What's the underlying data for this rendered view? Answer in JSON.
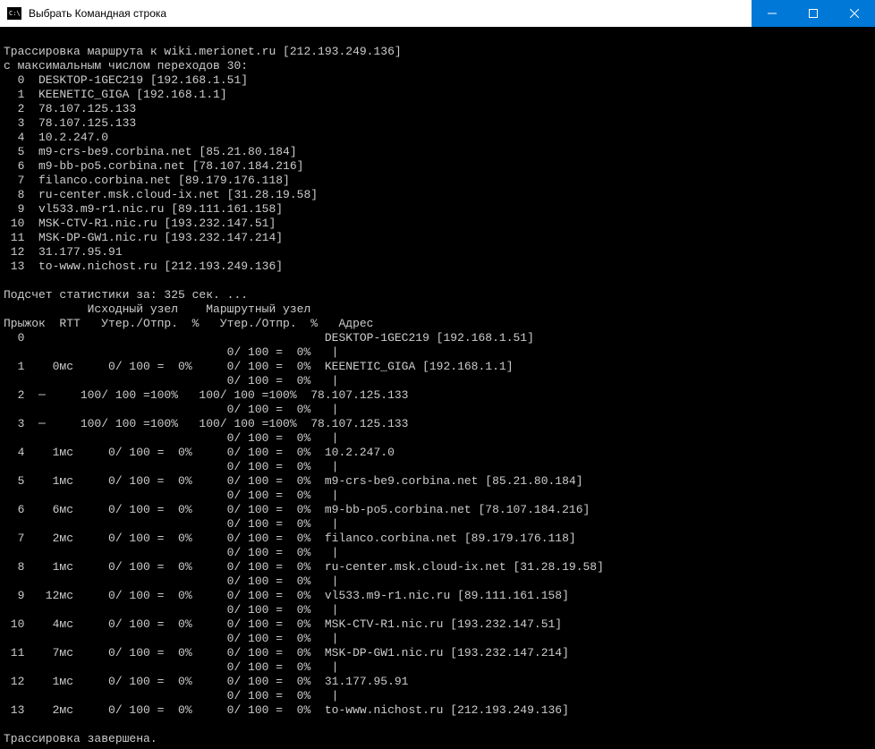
{
  "window": {
    "title": "Выбрать Командная строка"
  },
  "terminal": {
    "header1": "Трассировка маршрута к wiki.merionet.ru [212.193.249.136]",
    "header2": "с максимальным числом переходов 30:",
    "route": [
      "  0  DESKTOP-1GEC219 [192.168.1.51]",
      "  1  KEENETIC_GIGA [192.168.1.1]",
      "  2  78.107.125.133",
      "  3  78.107.125.133",
      "  4  10.2.247.0",
      "  5  m9-crs-be9.corbina.net [85.21.80.184]",
      "  6  m9-bb-po5.corbina.net [78.107.184.216]",
      "  7  filanco.corbina.net [89.179.176.118]",
      "  8  ru-center.msk.cloud-ix.net [31.28.19.58]",
      "  9  vl533.m9-r1.nic.ru [89.111.161.158]",
      " 10  MSK-CTV-R1.nic.ru [193.232.147.51]",
      " 11  MSK-DP-GW1.nic.ru [193.232.147.214]",
      " 12  31.177.95.91",
      " 13  to-www.nichost.ru [212.193.249.136]"
    ],
    "statsHeader1": "Подсчет статистики за: 325 сек. ...",
    "statsHeader2": "            Исходный узел    Маршрутный узел",
    "statsHeader3": "Прыжок  RTT   Утер./Отпр.  %   Утер./Отпр.  %   Адрес",
    "stats": [
      "  0                                           DESKTOP-1GEC219 [192.168.1.51]",
      "                                0/ 100 =  0%   |",
      "  1    0мс     0/ 100 =  0%     0/ 100 =  0%  KEENETIC_GIGA [192.168.1.1]",
      "                                0/ 100 =  0%   |",
      "  2  ─     100/ 100 =100%   100/ 100 =100%  78.107.125.133",
      "                                0/ 100 =  0%   |",
      "  3  ─     100/ 100 =100%   100/ 100 =100%  78.107.125.133",
      "                                0/ 100 =  0%   |",
      "  4    1мс     0/ 100 =  0%     0/ 100 =  0%  10.2.247.0",
      "                                0/ 100 =  0%   |",
      "  5    1мс     0/ 100 =  0%     0/ 100 =  0%  m9-crs-be9.corbina.net [85.21.80.184]",
      "                                0/ 100 =  0%   |",
      "  6    6мс     0/ 100 =  0%     0/ 100 =  0%  m9-bb-po5.corbina.net [78.107.184.216]",
      "                                0/ 100 =  0%   |",
      "  7    2мс     0/ 100 =  0%     0/ 100 =  0%  filanco.corbina.net [89.179.176.118]",
      "                                0/ 100 =  0%   |",
      "  8    1мс     0/ 100 =  0%     0/ 100 =  0%  ru-center.msk.cloud-ix.net [31.28.19.58]",
      "                                0/ 100 =  0%   |",
      "  9   12мс     0/ 100 =  0%     0/ 100 =  0%  vl533.m9-r1.nic.ru [89.111.161.158]",
      "                                0/ 100 =  0%   |",
      " 10    4мс     0/ 100 =  0%     0/ 100 =  0%  MSK-CTV-R1.nic.ru [193.232.147.51]",
      "                                0/ 100 =  0%   |",
      " 11    7мс     0/ 100 =  0%     0/ 100 =  0%  MSK-DP-GW1.nic.ru [193.232.147.214]",
      "                                0/ 100 =  0%   |",
      " 12    1мс     0/ 100 =  0%     0/ 100 =  0%  31.177.95.91",
      "                                0/ 100 =  0%   |",
      " 13    2мс     0/ 100 =  0%     0/ 100 =  0%  to-www.nichost.ru [212.193.249.136]"
    ],
    "footer": "Трассировка завершена."
  }
}
